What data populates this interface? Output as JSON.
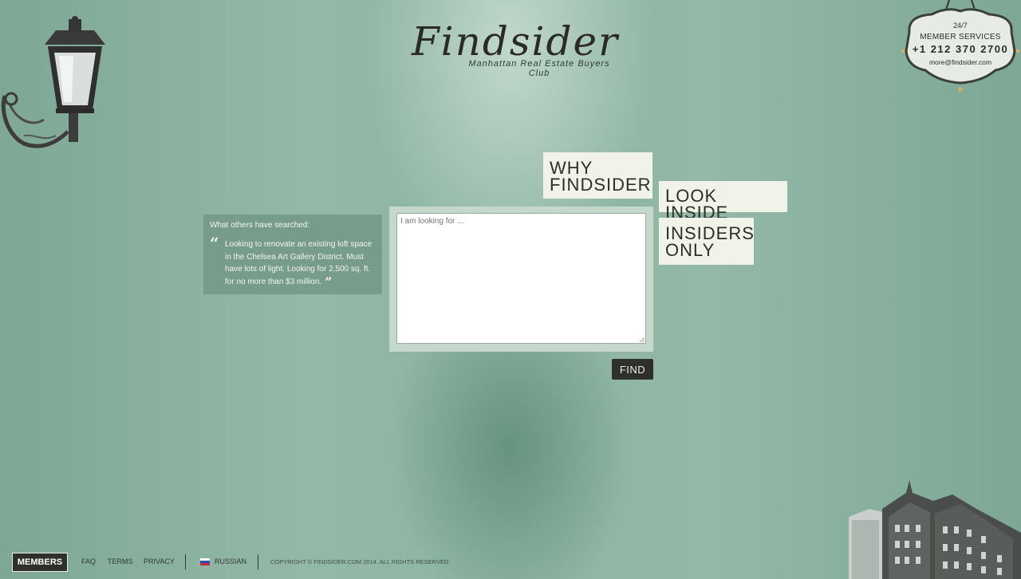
{
  "brand": {
    "name": "Findsider",
    "tagline": "Manhattan Real Estate Buyers Club"
  },
  "member_services": {
    "hours": "24/7",
    "label": "MEMBER SERVICES",
    "phone": "+1 212 370 2700",
    "email": "more@findsider.com"
  },
  "nav": {
    "why_line1": "WHY",
    "why_line2": "FINDSIDER",
    "look_inside": "LOOK INSIDE",
    "insiders_line1": "INSIDERS",
    "insiders_line2": "ONLY"
  },
  "search": {
    "placeholder": "I am looking for ...",
    "button_label": "FIND"
  },
  "others_searched": {
    "title": "What others have searched:",
    "quote": "Looking to renovate an existing loft space in the Chelsea Art Gallery District. Must have lots of light. Looking for 2,500 sq. ft. for no more than $3 million."
  },
  "footer": {
    "members_label": "MEMBERS",
    "faq": "FAQ",
    "terms": "TERMS",
    "privacy": "PRIVACY",
    "language": "RUSSIAN",
    "copyright": "COPYRIGHT © FINDSIDER.COM 2014. ALL RIGHTS RESERVED."
  },
  "colors": {
    "background": "#8eb4a3",
    "tile": "#f1f2e8",
    "button_dark": "#2f2f2c",
    "panel": "#779d8a"
  },
  "icons": [
    "street-lamp-icon",
    "quote-open-icon",
    "quote-close-icon",
    "russia-flag-icon",
    "building-illustration"
  ]
}
